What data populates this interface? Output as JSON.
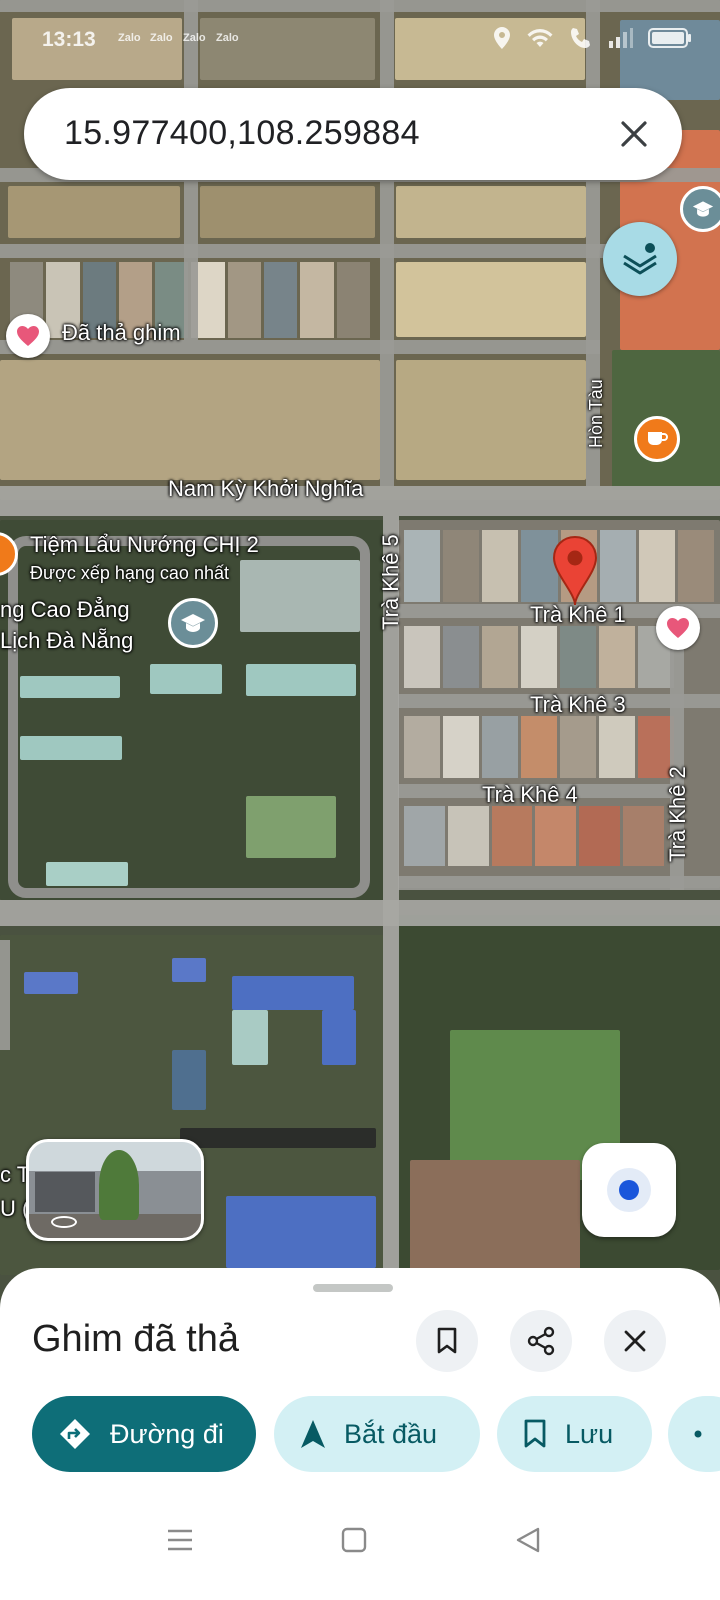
{
  "status_bar": {
    "time": "13:13",
    "notifications": [
      "Zalo",
      "Zalo",
      "Zalo",
      "Zalo"
    ],
    "icons": [
      "location-icon",
      "wifi-icon",
      "call-icon",
      "signal-icon",
      "battery-icon"
    ]
  },
  "search": {
    "query": "15.977400,108.259884",
    "clear_icon": "close-icon"
  },
  "map": {
    "labels": {
      "dropped_pin": "Đã thả ghim",
      "nam_ky_khoi_nghia": "Nam Kỳ Khởi Nghĩa",
      "hon_tau": "Hòn Tàu",
      "tiem_lau": "Tiệm Lẩu Nướng CHỊ 2",
      "tiem_lau_sub": "Được xếp hạng cao nhất",
      "college_line1": "ng Cao Đẳng",
      "college_line2": "Lịch Đà Nẵng",
      "tra_khe_5": "Trà Khê 5",
      "tra_khe_1": "Trà Khê 1",
      "tra_khe_3": "Trà Khê 3",
      "tra_khe_4": "Trà Khê 4",
      "tra_khe_2": "Trà Khê 2",
      "edge_left_1": "c T",
      "edge_left_2": "U (A"
    },
    "colors": {
      "pin_red": "#ea4335",
      "favorite_pink": "#e8577a",
      "cafe_orange": "#f07a1a",
      "accent_teal": "#0e6e78"
    }
  },
  "sheet": {
    "title": "Ghim đã thả",
    "icons": [
      "bookmark-icon",
      "share-icon",
      "close-icon"
    ],
    "actions": {
      "directions": "Đường đi",
      "start": "Bắt đầu",
      "save": "Lưu"
    }
  },
  "nav_bar": [
    "menu-icon",
    "home-icon",
    "back-icon"
  ]
}
